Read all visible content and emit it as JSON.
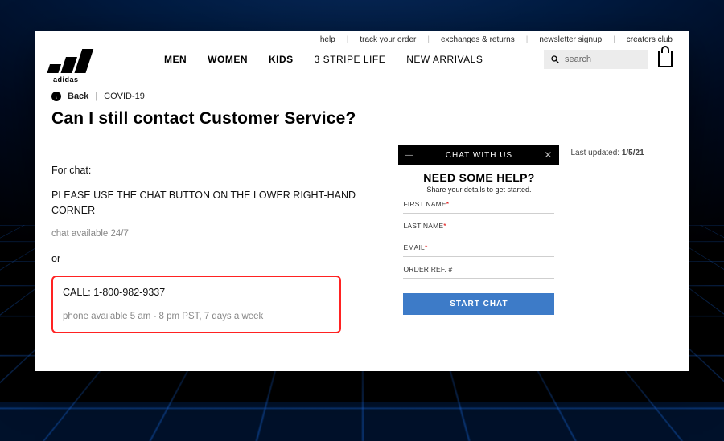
{
  "utility_nav": {
    "help": "help",
    "track": "track your order",
    "exch": "exchanges & returns",
    "news": "newsletter signup",
    "club": "creators club"
  },
  "brand_text": "adidas",
  "nav": {
    "men": "MEN",
    "women": "WOMEN",
    "kids": "KIDS",
    "stripe": "3 STRIPE LIFE",
    "newarr": "NEW ARRIVALS"
  },
  "search_placeholder": "search",
  "breadcrumb": {
    "back": "Back",
    "cat": "COVID-19"
  },
  "page_title": "Can I still contact Customer Service?",
  "last_updated_label": "Last updated:",
  "last_updated_value": "1/5/21",
  "body": {
    "for_chat": "For chat:",
    "chat_line": "PLEASE USE THE CHAT BUTTON ON THE LOWER RIGHT-HAND CORNER",
    "chat_avail": "chat available 24/7",
    "or": "or",
    "call": "CALL: 1-800-982-9337",
    "phone_avail": "phone available 5 am - 8 pm PST,  7 days a week"
  },
  "chat": {
    "header": "CHAT WITH US",
    "need_help": "NEED SOME HELP?",
    "sub": "Share your details to get started.",
    "first": "FIRST NAME",
    "last": "LAST NAME",
    "email": "EMAIL",
    "order": "ORDER REF. #",
    "start": "START CHAT",
    "req": "*"
  }
}
